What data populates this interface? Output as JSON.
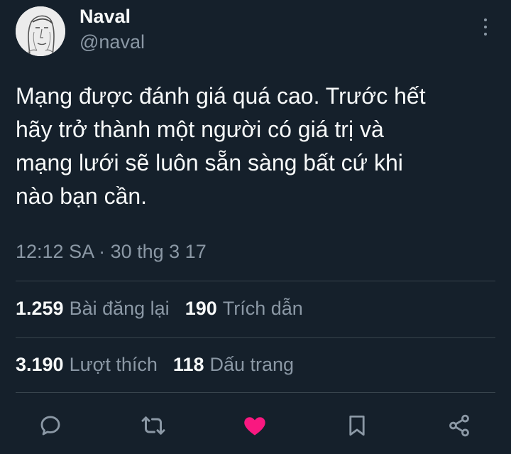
{
  "author": {
    "name": "Naval",
    "handle": "@naval",
    "avatar_icon": "avatar-sketch-portrait"
  },
  "tweet": {
    "text": "Mạng được đánh giá quá cao. Trước hết\nhãy trở thành một người có giá trị và\nmạng lưới sẽ luôn sẵn sàng bất cứ khi\nnào bạn cần.",
    "timestamp": "12:12 SA · 30 thg 3 17"
  },
  "stats": {
    "reposts_count": "1.259",
    "reposts_label": "Bài đăng lại",
    "quotes_count": "190",
    "quotes_label": "Trích dẫn",
    "likes_count": "3.190",
    "likes_label": "Lượt thích",
    "bookmarks_count": "118",
    "bookmarks_label": "Dấu trang"
  },
  "actions": {
    "icons": [
      "reply-icon",
      "repost-icon",
      "like-icon",
      "bookmark-icon",
      "share-icon"
    ],
    "like_active": true
  },
  "colors": {
    "background": "#15202b",
    "text_primary": "#f7f9f9",
    "text_secondary": "#8b98a5",
    "divider": "#38444d",
    "like_active": "#f91880"
  }
}
